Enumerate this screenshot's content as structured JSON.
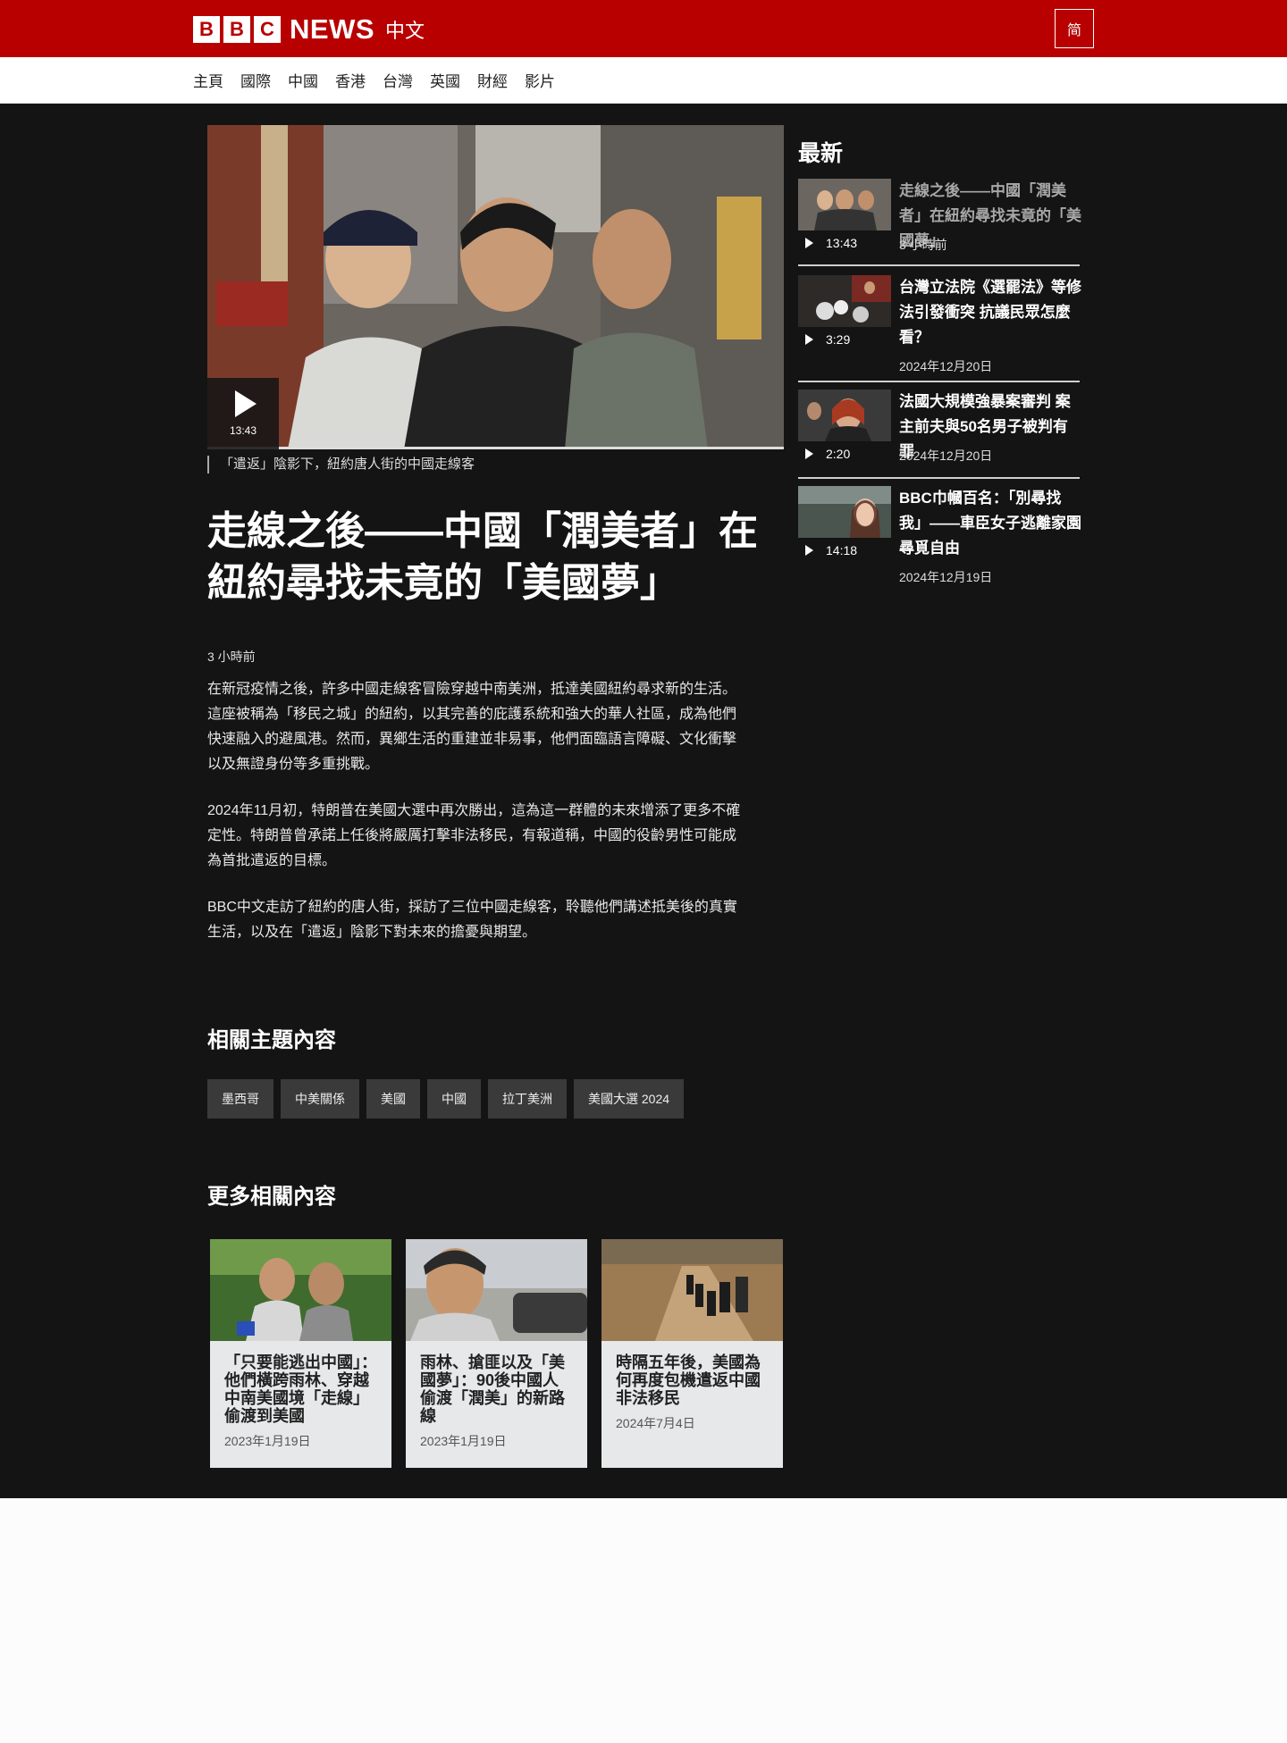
{
  "header": {
    "logo_letters": [
      "B",
      "B",
      "C"
    ],
    "logo_news": "NEWS",
    "logo_zh": "中文",
    "lang_toggle": "简",
    "brand_color": "#b80000"
  },
  "nav": {
    "items": [
      "主頁",
      "國際",
      "中國",
      "香港",
      "台灣",
      "英國",
      "財經",
      "影片"
    ]
  },
  "article": {
    "video_duration": "13:43",
    "caption": "「遣返」陰影下，紐約唐人街的中國走線客",
    "headline": "走線之後——中國「潤美者」在紐約尋找未竟的「美國夢」",
    "timestamp": "3 小時前",
    "paragraphs": [
      "在新冠疫情之後，許多中國走線客冒險穿越中南美洲，抵達美國紐約尋求新的生活。這座被稱為「移民之城」的紐約，以其完善的庇護系統和強大的華人社區，成為他們快速融入的避風港。然而，異鄉生活的重建並非易事，他們面臨語言障礙、文化衝擊以及無證身份等多重挑戰。",
      "2024年11月初，特朗普在美國大選中再次勝出，這為這一群體的未來增添了更多不確定性。特朗普曾承諾上任後將嚴厲打擊非法移民，有報道稱，中國的役齡男性可能成為首批遣返的目標。",
      "BBC中文走訪了紐約的唐人街，採訪了三位中國走線客，聆聽他們講述抵美後的真實生活，以及在「遣返」陰影下對未來的擔憂與期望。"
    ]
  },
  "related_topics": {
    "heading": "相關主題內容",
    "tags": [
      "墨西哥",
      "中美關係",
      "美國",
      "中國",
      "拉丁美洲",
      "美國大選 2024"
    ]
  },
  "more_related": {
    "heading": "更多相關內容",
    "cards": [
      {
        "title": "「只要能逃出中國」：他們橫跨雨林、穿越中南美國境「走線」偷渡到美國",
        "date": "2023年1月19日"
      },
      {
        "title": "雨林、搶匪以及「美國夢」：90後中國人偷渡「潤美」的新路線",
        "date": "2023年1月19日"
      },
      {
        "title": "時隔五年後，美國為何再度包機遣返中國非法移民",
        "date": "2024年7月4日"
      }
    ]
  },
  "latest": {
    "heading": "最新",
    "items": [
      {
        "title": "走線之後——中國「潤美者」在紐約尋找未竟的「美國夢」",
        "duration": "13:43",
        "date": "3 小時前"
      },
      {
        "title": "台灣立法院《選罷法》等修法引發衝突 抗議民眾怎麼看？",
        "duration": "3:29",
        "date": "2024年12月20日"
      },
      {
        "title": "法國大規模強暴案審判 案主前夫與50名男子被判有罪",
        "duration": "2:20",
        "date": "2024年12月20日"
      },
      {
        "title": "BBC巾幗百名：「別尋找我」——車臣女子逃離家園尋覓自由",
        "duration": "14:18",
        "date": "2024年12月19日"
      }
    ]
  }
}
